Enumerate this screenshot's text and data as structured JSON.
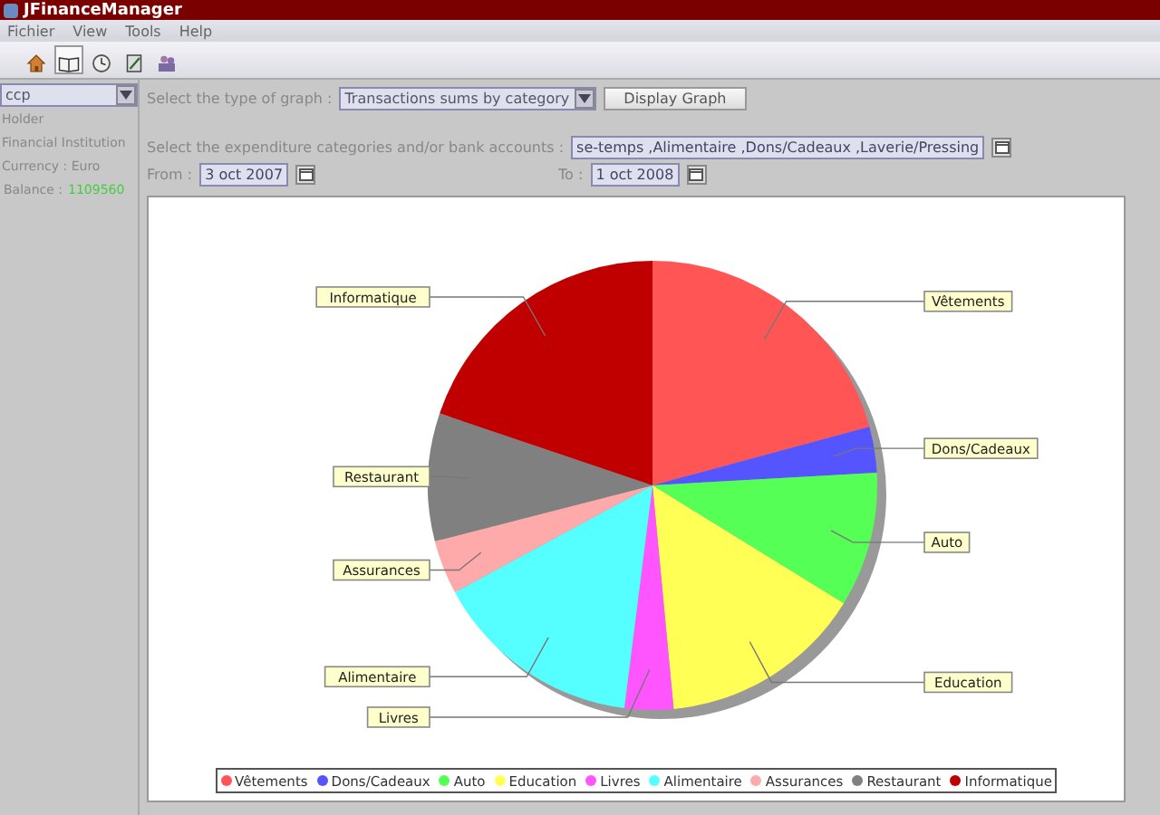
{
  "window": {
    "title": "JFinanceManager"
  },
  "menu": [
    "Fichier",
    "View",
    "Tools",
    "Help"
  ],
  "toolbar": [
    {
      "selected": false
    },
    {
      "selected": true
    },
    {
      "selected": false
    },
    {
      "selected": false
    },
    {
      "selected": false
    }
  ],
  "sidebar": {
    "account": "ccp",
    "lines": [
      "Holder",
      "Financial Institution",
      "Currency : Euro"
    ],
    "balance_label": "Balance :",
    "balance_value": "1109560"
  },
  "graph_type": {
    "label": "Select the type of graph :",
    "value": "Transactions sums by category",
    "button": "Display Graph"
  },
  "categories": {
    "label": "Select the expenditure categories and/or bank accounts :",
    "value": "se-temps ,Alimentaire ,Dons/Cadeaux ,Laverie/Pressing"
  },
  "from": {
    "label": "From :",
    "value": "3 oct 2007"
  },
  "to": {
    "label": "To :",
    "value": "1 oct 2008"
  },
  "chart": {
    "chart_data": {
      "type": "pie",
      "categories": [
        "Vêtements",
        "Dons/Cadeaux",
        "Auto",
        "Education",
        "Livres",
        "Alimentaire",
        "Assurances",
        "Restaurant",
        "Informatique"
      ],
      "values": [
        20.8,
        3.3,
        9.7,
        14.7,
        3.5,
        15.1,
        3.9,
        9.2,
        19.8
      ],
      "colors": [
        "#ff5555",
        "#5555ff",
        "#55ff55",
        "#ffff55",
        "#ff55ff",
        "#55ffff",
        "#ffaaaa",
        "#808080",
        "#c00000"
      ]
    }
  }
}
